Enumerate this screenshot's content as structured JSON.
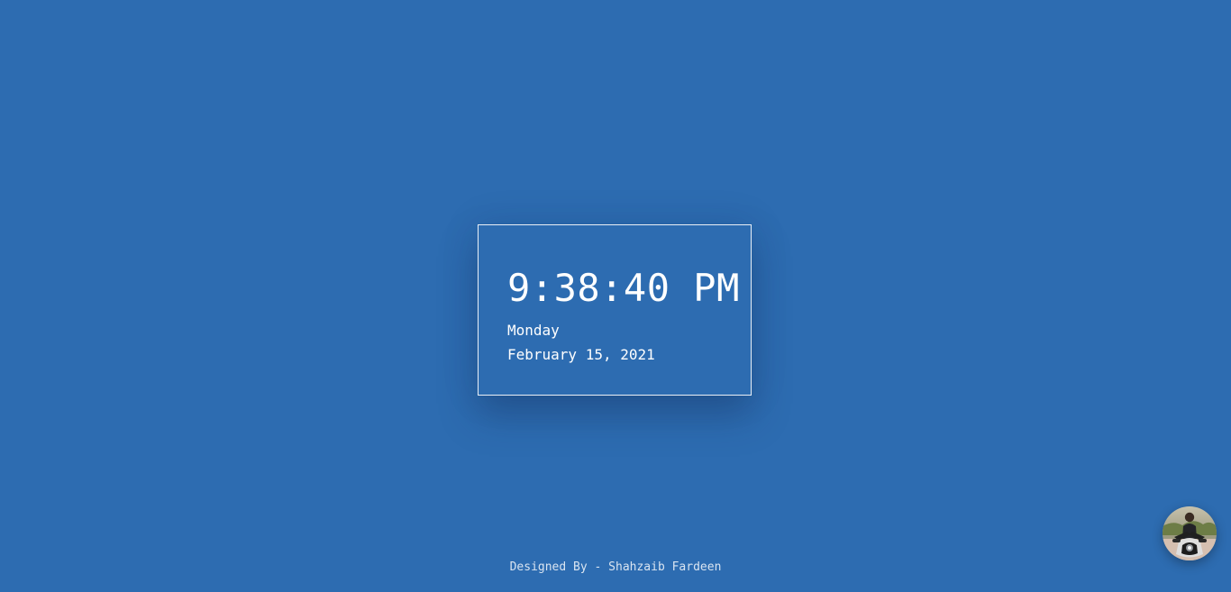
{
  "clock": {
    "time": "9:38:40 PM",
    "day": "Monday",
    "date": "February 15, 2021"
  },
  "footer": {
    "credit": "Designed By - Shahzaib Fardeen"
  },
  "colors": {
    "background": "#2d6cb1",
    "text": "#ffffff"
  },
  "avatar": {
    "icon": "profile-photo-icon"
  }
}
